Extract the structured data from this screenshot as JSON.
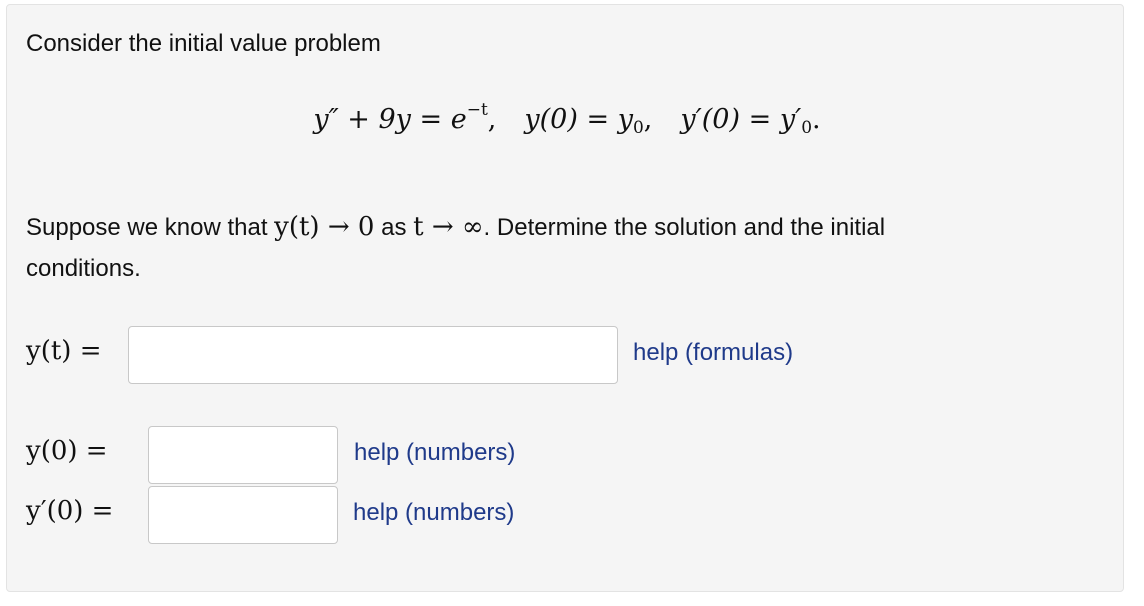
{
  "problem": {
    "intro": "Consider the initial value problem",
    "equation": {
      "lhs": "y″ + 9y",
      "eq": " = ",
      "rhs_base": "e",
      "rhs_exp": "−t",
      "sep": ",",
      "ic1_lhs": "y(0)",
      "ic1_rhs_base": "y",
      "ic1_rhs_sub": "0",
      "ic2_lhs": "y′(0)",
      "ic2_rhs_base": "y′",
      "ic2_rhs_sub": "0",
      "end": "."
    },
    "question": {
      "part1": "Suppose we know that ",
      "math1": "y(t) → 0",
      "part2": " as ",
      "math2": "t → ∞",
      "part3": ". Determine the solution and the initial",
      "line2": "conditions."
    }
  },
  "answers": {
    "yt": {
      "label": "y(t) =",
      "value": "",
      "help": "help (formulas)"
    },
    "y0": {
      "label": "y(0) =",
      "value": "",
      "help": "help (numbers)"
    },
    "yp0": {
      "label": "y′(0) =",
      "value": "",
      "help": "help (numbers)"
    }
  }
}
